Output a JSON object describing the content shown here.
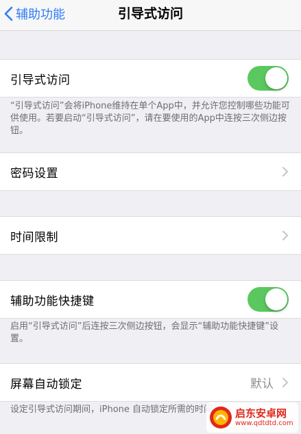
{
  "nav": {
    "back_label": "辅助功能",
    "title": "引导式访问"
  },
  "guided_access": {
    "label": "引导式访问",
    "enabled": true,
    "footer": "“引导式访问”会将iPhone维持在单个App中，并允许您控制哪些功能可供使用。若要启动“引导式访问”，请在要使用的App中连按三次侧边按钮。"
  },
  "passcode": {
    "label": "密码设置"
  },
  "time_limits": {
    "label": "时间限制"
  },
  "accessibility_shortcut": {
    "label": "辅助功能快捷键",
    "enabled": true,
    "footer": "启用“引导式访问”后连按三次侧边按钮，会显示“辅助功能快捷键”设置。"
  },
  "auto_lock": {
    "label": "屏幕自动锁定",
    "value": "默认",
    "footer": "设定引导式访问期间，iPhone 自动锁定所需的时间"
  },
  "watermark": {
    "name": "启东安卓网",
    "url": "www.qdtdtd.com"
  },
  "colors": {
    "accent": "#2f7cf6",
    "toggle_on": "#5ac85e",
    "background": "#efeff4",
    "watermark": "#e0281c"
  }
}
